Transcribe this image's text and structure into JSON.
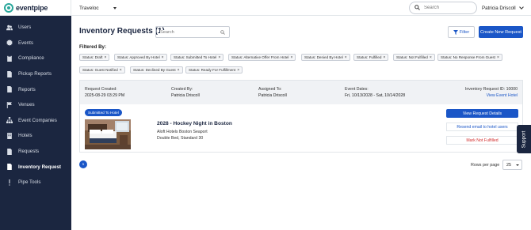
{
  "brand": {
    "name": "eventpipe",
    "color": "#2aa79b"
  },
  "colors": {
    "sidebar_bg": "#1b2640",
    "accent": "#1a56c7",
    "danger": "#d32f2f"
  },
  "sidebar": {
    "items": [
      {
        "label": "Users",
        "icon": "users-icon"
      },
      {
        "label": "Events",
        "icon": "gear-icon"
      },
      {
        "label": "Compliance",
        "icon": "clipboard-icon"
      },
      {
        "label": "Pickup Reports",
        "icon": "document-icon"
      },
      {
        "label": "Reports",
        "icon": "document-icon"
      },
      {
        "label": "Venues",
        "icon": "flag-icon"
      },
      {
        "label": "Event Companies",
        "icon": "sitemap-icon"
      },
      {
        "label": "Hotels",
        "icon": "building-icon"
      },
      {
        "label": "Requests",
        "icon": "file-icon"
      },
      {
        "label": "Inventory Request",
        "icon": "file-icon",
        "active": true
      },
      {
        "label": "Pipe Tools",
        "icon": "exclamation-icon"
      }
    ]
  },
  "topbar": {
    "org": "Traveloc",
    "search_placeholder": "Search",
    "user": "Patricia Driscoll"
  },
  "main": {
    "title": "Inventory Requests (1)",
    "search_placeholder": "Search",
    "filter_label": "Filter",
    "new_button": "Create New Request",
    "filtered_by": "Filtered By:",
    "chips": [
      "Status: Draft",
      "Status: Approved By Hotel",
      "Status: Submitted To Hotel",
      "Status: Alternative Offer From Hotel",
      "Status: Denied By Hotel",
      "Status: Fulfilled",
      "Status: Not Fulfilled",
      "Status: No Response From Guest",
      "Status: Guest Notified",
      "Status: Declined By Guest",
      "Status: Ready For Fulfillment"
    ],
    "chip_remove": "×"
  },
  "request": {
    "created_label": "Request Created:",
    "created_value": "2025-08-29 03:29 PM",
    "created_by_label": "Created By:",
    "created_by_value": "Patricia Driscoll",
    "assigned_label": "Assigned To:",
    "assigned_value": "Patricia Driscoll",
    "dates_label": "Event Dates:",
    "dates_value": "Fri, 10/13/2028 - Sat, 10/14/2028",
    "id_text": "Inventory Request ID: 10000",
    "view_event": "View Event Hotel",
    "status": "Submitted To Hotel",
    "event_title": "2028 - Hockey Night in Boston",
    "hotel": "Aloft Hotels Boston Seaport",
    "room": "Double Bed, Standard",
    "room_count": "30",
    "btn_details": "View Request Details",
    "btn_resend": "Resend email to hotel users",
    "btn_not_fulfilled": "Mark Not Fulfilled"
  },
  "pagination": {
    "current_page": "1",
    "rows_label": "Rows per page",
    "rows_value": "25"
  },
  "support": {
    "label": "Support"
  }
}
